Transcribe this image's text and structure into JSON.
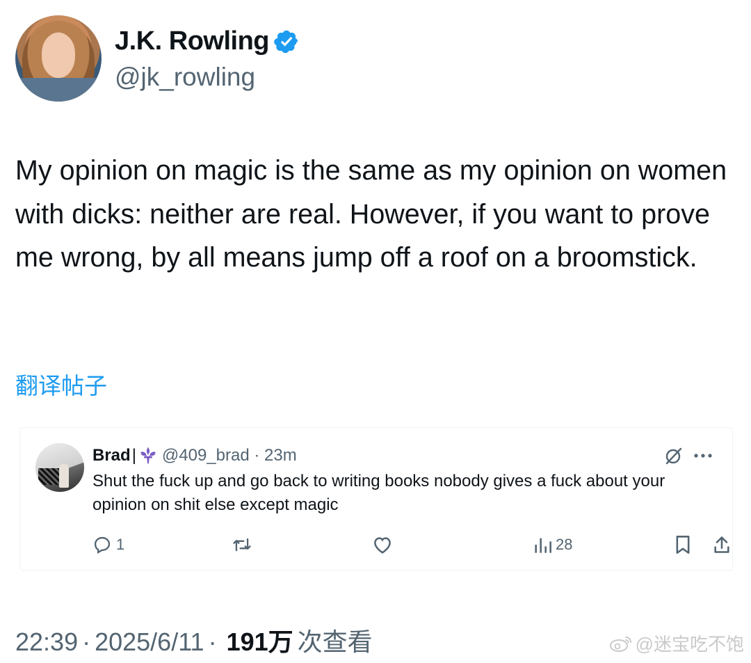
{
  "author": {
    "display_name": "J.K. Rowling",
    "handle": "@jk_rowling",
    "verified_color": "#1d9bf0"
  },
  "tweet": {
    "text": "My opinion on magic is the same as my opinion on women with dicks: neither are real. However, if you want to prove me wrong, by all means jump off a roof on a broomstick.",
    "translate_label": "翻译帖子"
  },
  "reply": {
    "name": "Brad",
    "separator": "|",
    "emoji_icon": "fleur-de-lis-icon",
    "handle_time": "@409_brad · 23m",
    "text": "Shut the fuck up and go back to writing books nobody gives a fuck about your opinion on shit else except magic",
    "actions": {
      "reply_count": "1",
      "retweet_count": "",
      "like_count": "",
      "views_count": "28"
    }
  },
  "meta": {
    "time": "22:39",
    "date": "2025/6/11",
    "views_number": "191万",
    "views_label": "次查看"
  },
  "watermark": {
    "text": "@迷宝吃不饱"
  },
  "colors": {
    "accent": "#1d9bf0",
    "secondary_text": "#536471",
    "primary_text": "#0f1419"
  }
}
